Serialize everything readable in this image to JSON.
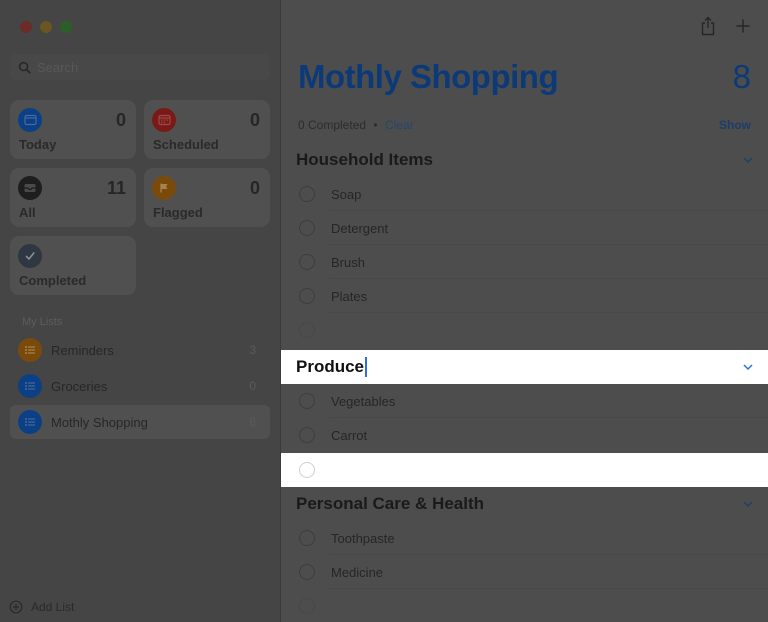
{
  "sidebar": {
    "search": {
      "placeholder": "Search",
      "value": ""
    },
    "smart_lists": [
      {
        "id": "today",
        "label": "Today",
        "count": "0",
        "icon": "calendar-today-icon",
        "color": "#0b3f86"
      },
      {
        "id": "scheduled",
        "label": "Scheduled",
        "count": "0",
        "icon": "calendar-icon",
        "color": "#7a1a18"
      },
      {
        "id": "all",
        "label": "All",
        "count": "11",
        "icon": "tray-icon",
        "color": "#1e1e1e"
      },
      {
        "id": "flagged",
        "label": "Flagged",
        "count": "0",
        "icon": "flag-icon",
        "color": "#7a4a0a"
      },
      {
        "id": "completed",
        "label": "Completed",
        "count": "",
        "icon": "checkmark-icon",
        "color": "#2f3742"
      }
    ],
    "my_lists_title": "My Lists",
    "lists": [
      {
        "name": "Reminders",
        "count": "3",
        "color": "#7a4a0a",
        "selected": false
      },
      {
        "name": "Groceries",
        "count": "0",
        "color": "#0b3f86",
        "selected": false
      },
      {
        "name": "Mothly Shopping",
        "count": "8",
        "color": "#0b3f86",
        "selected": true
      }
    ],
    "add_list_label": "Add List"
  },
  "main": {
    "title": "Mothly Shopping",
    "count": "8",
    "completed_text": "0 Completed",
    "separator": "•",
    "clear_label": "Clear",
    "show_label": "Show",
    "accent_color": "#0c3a78",
    "sections": [
      {
        "title": "Household Items",
        "items": [
          "Soap",
          "Detergent",
          "Brush",
          "Plates",
          ""
        ],
        "editing": false
      },
      {
        "title": "Produce",
        "items": [
          "Vegetables",
          "Carrot",
          ""
        ],
        "editing": true
      },
      {
        "title": "Personal Care & Health",
        "items": [
          "Toothpaste",
          "Medicine",
          ""
        ],
        "editing": false
      }
    ]
  }
}
